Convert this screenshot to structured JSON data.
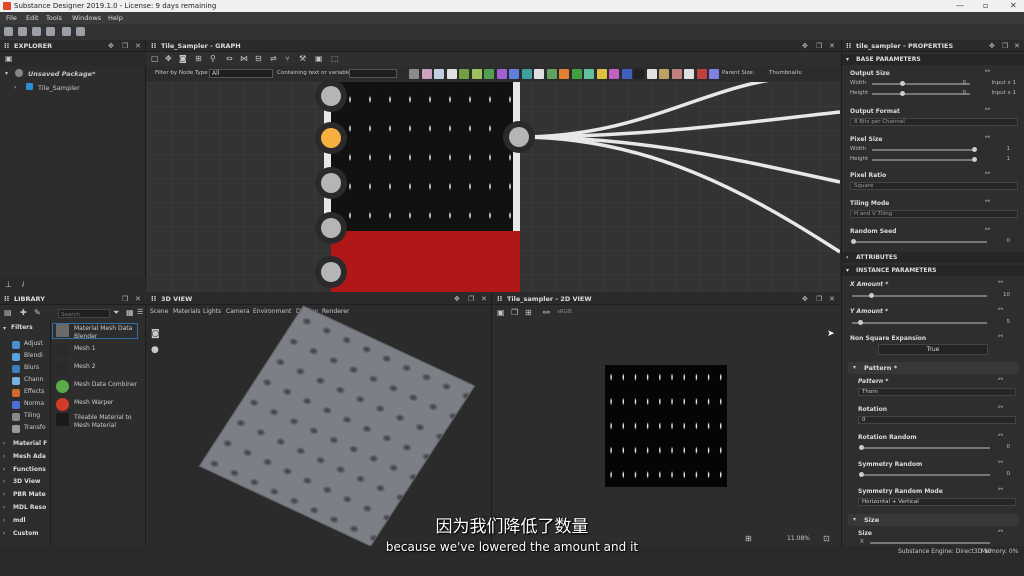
{
  "window": {
    "title": "Substance Designer 2019.1.0 - License: 9 days remaining"
  },
  "menu": [
    "File",
    "Edit",
    "Tools",
    "Windows",
    "Help"
  ],
  "explorer": {
    "title": "EXPLORER",
    "package": "Unsaved Package*",
    "item": "Tile_Sampler"
  },
  "graph": {
    "title": "Tile_Sampler - GRAPH",
    "filter_label": "Filter by Node Type",
    "filter_value": "All",
    "containing_label": "Containing text or variable",
    "parent_size": "Parent Size:",
    "thumbnails": "Thumbnails:"
  },
  "properties": {
    "title": "tile_sampler - PROPERTIES",
    "base_parameters": "BASE PARAMETERS",
    "output_size": "Output Size",
    "width": "Width",
    "height": "Height",
    "os_width_val": "0",
    "os_height_val": "0",
    "input_x1": "Input x 1",
    "input_x1b": "Input x 1",
    "output_format": "Output Format",
    "output_format_val": "8 Bits per Channel",
    "pixel_size": "Pixel Size",
    "px_width_val": "1",
    "px_height_val": "1",
    "pixel_ratio": "Pixel Ratio",
    "pixel_ratio_val": "Square",
    "tiling_mode": "Tiling Mode",
    "tiling_mode_val": "H and V Tiling",
    "random_seed": "Random Seed",
    "random_seed_val": "0",
    "attributes": "ATTRIBUTES",
    "instance_parameters": "INSTANCE PARAMETERS",
    "x_amount": "X Amount *",
    "x_amount_val": "10",
    "y_amount": "Y Amount *",
    "y_amount_val": "5",
    "non_square": "Non Square Expansion",
    "non_square_val": "True",
    "pattern_group": "Pattern *",
    "pattern": "Pattern *",
    "pattern_val": "Thorn",
    "rotation": "Rotation",
    "rotation_val": "0",
    "rotation_random": "Rotation Random",
    "rotation_random_val": "0",
    "symmetry_random": "Symmetry Random",
    "symmetry_random_val": "0",
    "symmetry_random_mode": "Symmetry Random Mode",
    "symmetry_random_mode_val": "Horizontal + Vertical",
    "size_group": "Size",
    "size": "Size",
    "size_x": "X"
  },
  "library": {
    "title": "LIBRARY",
    "search_placeholder": "Search",
    "filters_label": "Filters",
    "filters": [
      "Adjust",
      "Blendi",
      "Blurs",
      "Chann",
      "Effects",
      "Norma",
      "Tiling",
      "Transfo"
    ],
    "categories": [
      "Material F",
      "Mesh Ada",
      "Functions",
      "3D View",
      "PBR Mate",
      "MDL Reso",
      "mdl",
      "Custom"
    ],
    "items": [
      "Material Mesh Data Blender",
      "Mesh 1",
      "Mesh 2",
      "Mesh Data Combiner",
      "Mesh Warper",
      "Tileable Material to Mesh Material"
    ]
  },
  "view3d": {
    "title": "3D VIEW",
    "menu": [
      "Scene",
      "Materials",
      "Lights",
      "Camera",
      "Environment",
      "Display",
      "Renderer"
    ]
  },
  "view2d": {
    "title": "Tile_sampler - 2D VIEW",
    "zoom": "11.08%",
    "srgb": "sRGB"
  },
  "status": {
    "engine": "Substance Engine: Direct3D 10",
    "memory": "Memory: 0%"
  },
  "subtitles": {
    "chinese": "因为我们降低了数量",
    "english": "because we've lowered the amount and it"
  },
  "colors": {
    "accent_node": "#f5b041",
    "red_block": "#b01818"
  }
}
